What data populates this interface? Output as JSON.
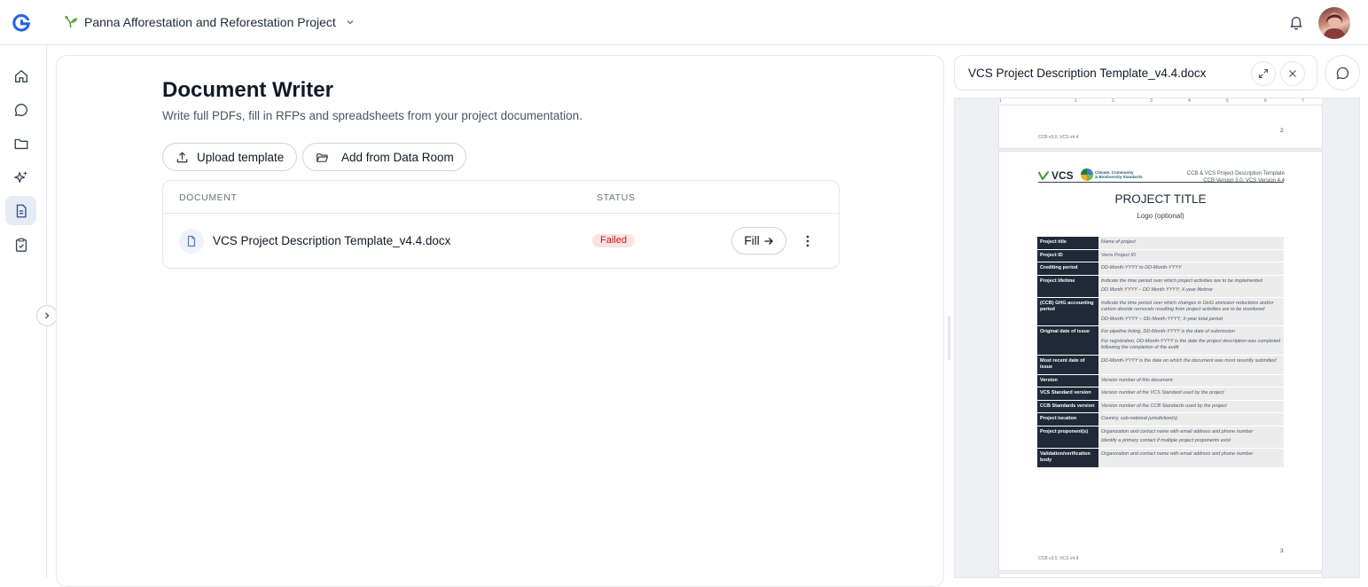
{
  "app": {
    "logo_letter": "G"
  },
  "header": {
    "project_name": "Panna Afforestation and Reforestation Project"
  },
  "sidebar": {
    "items": [
      {
        "name": "home",
        "active": false
      },
      {
        "name": "chat",
        "active": false
      },
      {
        "name": "folder",
        "active": false
      },
      {
        "name": "ai",
        "active": false
      },
      {
        "name": "document-writer",
        "active": true
      },
      {
        "name": "clipboard",
        "active": false
      }
    ]
  },
  "main": {
    "title": "Document Writer",
    "subtitle": "Write full PDFs, fill in RFPs and spreadsheets from your project documentation.",
    "upload_label": "Upload template",
    "dataroom_label": "Add from Data Room",
    "table": {
      "col_document": "DOCUMENT",
      "col_status": "STATUS",
      "rows": [
        {
          "name": "VCS Project Description Template_v4.4.docx",
          "status": "Failed",
          "action": "Fill"
        }
      ]
    }
  },
  "preview": {
    "title": "VCS Project Description Template_v4.4.docx",
    "ruler": [
      "1",
      "1",
      "2",
      "3",
      "4",
      "5",
      "6",
      "7"
    ],
    "page1": {
      "footer": "CCB v3.0, VCS v4.4",
      "number": "2"
    },
    "page2": {
      "vcs_logo": "VCS",
      "ccb_text_1": "Climate, Community",
      "ccb_text_2": "& Biodiversity Standards",
      "header_1": "CCB & VCS Project Description Template",
      "header_2": "CCB Version 3.0, VCS Version 4.4",
      "title": "PROJECT TITLE",
      "logo": "Logo (optional)",
      "fields": [
        {
          "k": "Project title",
          "v": [
            "Name of project"
          ]
        },
        {
          "k": "Project ID",
          "v": [
            "Verra Project ID"
          ]
        },
        {
          "k": "Crediting period",
          "v": [
            "DD-Month-YYYY to DD-Month-YYYY"
          ]
        },
        {
          "k": "Project lifetime",
          "v": [
            "Indicate the time period over which project activities are to be implemented",
            "DD Month YYYY – DD Month YYYY; X-year lifetime"
          ]
        },
        {
          "k": "(CCB) GHG accounting period",
          "v": [
            "Indicate the time period over which changes in GHG emission reductions and/or carbon dioxide removals resulting from project activities are to be monitored",
            "DD-Month-YYYY – DD-Month-YYYY; X-year total period"
          ]
        },
        {
          "k": "Original date of issue",
          "v": [
            "For pipeline listing, DD-Month-YYYY is the date of submission",
            "For registration, DD-Month-YYYY is the date the project description was completed following the completion of the audit"
          ]
        },
        {
          "k": "Most recent date of issue",
          "v": [
            "DD-Month-YYYY is the date on which the document was most recently submitted"
          ]
        },
        {
          "k": "Version",
          "v": [
            "Version number of this document"
          ]
        },
        {
          "k": "VCS Standard version",
          "v": [
            "Version number of the VCS Standard used by the project"
          ]
        },
        {
          "k": "CCB Standards version",
          "v": [
            "Version number of the CCB Standards used by the project"
          ]
        },
        {
          "k": "Project location",
          "v": [
            "Country, sub-national jurisdiction(s)"
          ]
        },
        {
          "k": "Project proponent(s)",
          "v": [
            "Organization and contact name with email address and phone number",
            "Identify a primary contact if multiple project proponents exist"
          ]
        },
        {
          "k": "Validation/verification body",
          "v": [
            "Organization and contact name with email address and phone number"
          ]
        }
      ],
      "footer": "CCB v3.0, VCS v4.4",
      "number": "3"
    }
  },
  "colors": {
    "accent": "#2563eb",
    "failed_bg": "#fde2e2",
    "failed_text": "#b91c1c",
    "table_key_bg": "#1f2937"
  }
}
